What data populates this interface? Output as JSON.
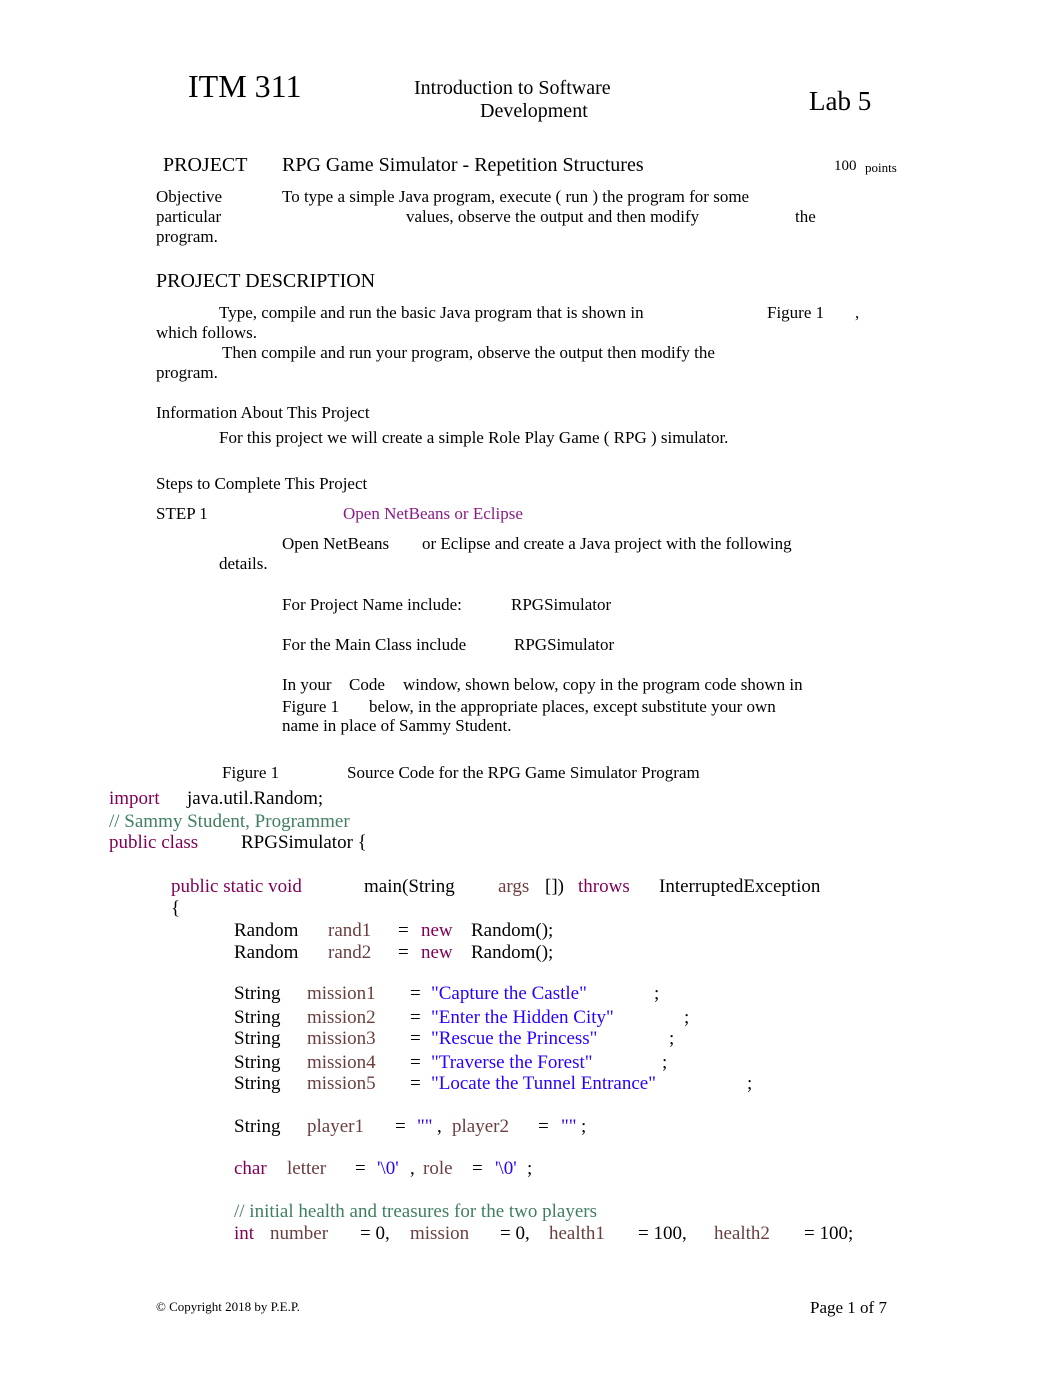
{
  "header": {
    "course": "ITM 311",
    "title_line1": "Introduction to Software",
    "title_line2": "Development",
    "lab": "Lab 5"
  },
  "project": {
    "label": "PROJECT",
    "name": "RPG Game Simulator - Repetition Structures",
    "points_value": "100",
    "points_label": "points"
  },
  "objective": {
    "label": "Objective",
    "line1": "To type a simple Java program, execute ( run ) the program for some",
    "line2_a": "particular",
    "line2_b": "values, observe the output and then modify",
    "line2_c": "the",
    "line3": "program."
  },
  "description": {
    "heading": "PROJECT DESCRIPTION",
    "p1_a": "Type, compile and run the basic Java program that is shown in",
    "p1_b": "Figure 1",
    "p1_c": ",",
    "p1_d": "which follows.",
    "p2_a": "Then compile and run your program, observe the output then modify the",
    "p2_b": "program."
  },
  "info": {
    "heading": "Information About This Project",
    "text": "For this project we will create a simple Role Play Game ( RPG ) simulator."
  },
  "steps": {
    "heading": "Steps to Complete This Project",
    "step1_label": "STEP 1",
    "step1_title": "Open NetBeans or Eclipse",
    "step1_line1_a": "Open NetBeans",
    "step1_line1_b": "or Eclipse and create a Java project with the following",
    "step1_line2": "details.",
    "project_name_label": "For Project Name include:",
    "project_name_value": "RPGSimulator",
    "main_class_label": "For the Main Class include",
    "main_class_value": "RPGSimulator",
    "code_line1_a": "In your",
    "code_line1_b": "Code",
    "code_line1_c": "window, shown below, copy in the program code shown in",
    "code_line2_a": "Figure 1",
    "code_line2_b": "below, in the appropriate places, except substitute your own",
    "code_line3": "name in place of Sammy Student."
  },
  "figure": {
    "label": "Figure 1",
    "caption": "Source Code for the RPG Game Simulator Program"
  },
  "code": {
    "import_kw": "import",
    "import_pkg": "java.util.Random;",
    "comment_author": "// Sammy Student, Programmer",
    "class_kw": "public class",
    "class_name": "RPGSimulator {",
    "main_kw": "public static void",
    "main_sig": "main(String",
    "main_args": "args",
    "main_brackets": "[])",
    "throws_kw": "throws",
    "exception": "InterruptedException",
    "open_brace": "{",
    "randoms": [
      {
        "type": "Random",
        "name": "rand1",
        "eq": "=",
        "new_kw": "new",
        "ctor": "Random();"
      },
      {
        "type": "Random",
        "name": "rand2",
        "eq": "=",
        "new_kw": "new",
        "ctor": "Random();"
      }
    ],
    "missions": [
      {
        "type": "String",
        "name": "mission1",
        "eq": "=",
        "value": "\"Capture the Castle\"",
        "semi": ";"
      },
      {
        "type": "String",
        "name": "mission2",
        "eq": "=",
        "value": "\"Enter the Hidden City\"",
        "semi": ";"
      },
      {
        "type": "String",
        "name": "mission3",
        "eq": "=",
        "value": "\"Rescue the Princess\"",
        "semi": ";"
      },
      {
        "type": "String",
        "name": "mission4",
        "eq": "=",
        "value": "\"Traverse the Forest\"",
        "semi": ";"
      },
      {
        "type": "String",
        "name": "mission5",
        "eq": "=",
        "value": "\"Locate the Tunnel Entrance\"",
        "semi": ";"
      }
    ],
    "players": {
      "type": "String",
      "name1": "player1",
      "eq1": "=",
      "val1": "\"\"",
      "comma": ",",
      "name2": "player2",
      "eq2": "=",
      "val2": "\"\"",
      "semi": ";"
    },
    "chars": {
      "type": "char",
      "name1": "letter",
      "eq1": "=",
      "val1": "'\\0'",
      "comma": ",",
      "name2": "role",
      "eq2": "=",
      "val2": "'\\0'",
      "semi": ";"
    },
    "comment_health": "// initial health and treasures for the two players",
    "ints": {
      "type": "int",
      "v1": "number",
      "a1": "= 0,",
      "v2": "mission",
      "a2": "= 0,",
      "v3": "health1",
      "a3": "= 100,",
      "v4": "health2",
      "a4": "= 100;"
    }
  },
  "footer": {
    "copyright": "© Copyright 2018 by P.E.P.",
    "page": "Page 1 of 7"
  },
  "colors": {
    "keyword": "#7f0055",
    "variable": "#6a3e3e",
    "string": "#2a00ff",
    "comment": "#3f7f5f",
    "step_title": "#8b1a89"
  }
}
